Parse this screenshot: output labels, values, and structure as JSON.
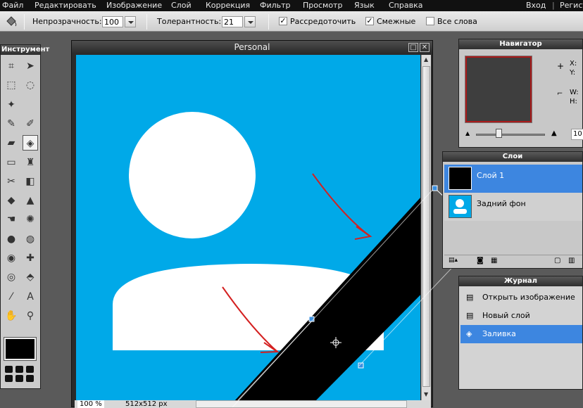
{
  "menu": {
    "items": [
      "Файл",
      "Редактировать",
      "Изображение",
      "Слой",
      "Коррекция",
      "Фильтр",
      "Просмотр",
      "Язык",
      "Справка"
    ],
    "login": "Вход",
    "separator": "|",
    "register": "Регист"
  },
  "options": {
    "opacity_label": "Непрозрачность:",
    "opacity_value": "100",
    "tolerance_label": "Толерантность:",
    "tolerance_value": "21",
    "antialias_label": "Рассредоточить",
    "antialias_checked": true,
    "contiguous_label": "Смежные",
    "contiguous_checked": true,
    "all_layers_label": "Все слова",
    "all_layers_checked": false
  },
  "tools": {
    "title": "Инструмент",
    "icons": [
      "crop-icon",
      "move-icon",
      "marquee-icon",
      "lasso-icon",
      "magic-wand-icon",
      "",
      "pencil-icon",
      "brush-icon",
      "eraser-icon",
      "paint-bucket-icon",
      "gradient-icon",
      "clone-stamp-icon",
      "color-replace-icon",
      "shape-icon",
      "blur-icon",
      "sharpen-icon",
      "smudge-icon",
      "sponge-icon",
      "burn-icon",
      "dodge-icon",
      "red-eye-icon",
      "spot-heal-icon",
      "bloat-icon",
      "pinch-icon",
      "color-picker-icon",
      "type-icon",
      "hand-icon",
      "zoom-icon"
    ]
  },
  "document": {
    "title": "Personal",
    "zoom": "100",
    "zoom_unit": "%",
    "size": "512x512 px"
  },
  "navigator": {
    "title": "Навигатор",
    "x_label": "X:",
    "y_label": "Y:",
    "w_label": "W:",
    "h_label": "H:",
    "zoom_value": "10"
  },
  "layers": {
    "title": "Слои",
    "items": [
      {
        "name": "Слой 1",
        "selected": true
      },
      {
        "name": "Задний фон",
        "selected": false
      }
    ]
  },
  "history": {
    "title": "Журнал",
    "items": [
      {
        "label": "Открыть изображение",
        "selected": false
      },
      {
        "label": "Новый слой",
        "selected": false
      },
      {
        "label": "Заливка",
        "selected": true
      }
    ]
  },
  "colors": {
    "canvas": "#00a9e8",
    "selection": "#3a8fe0",
    "annotation": "#d42020",
    "foreground": "#000000"
  }
}
